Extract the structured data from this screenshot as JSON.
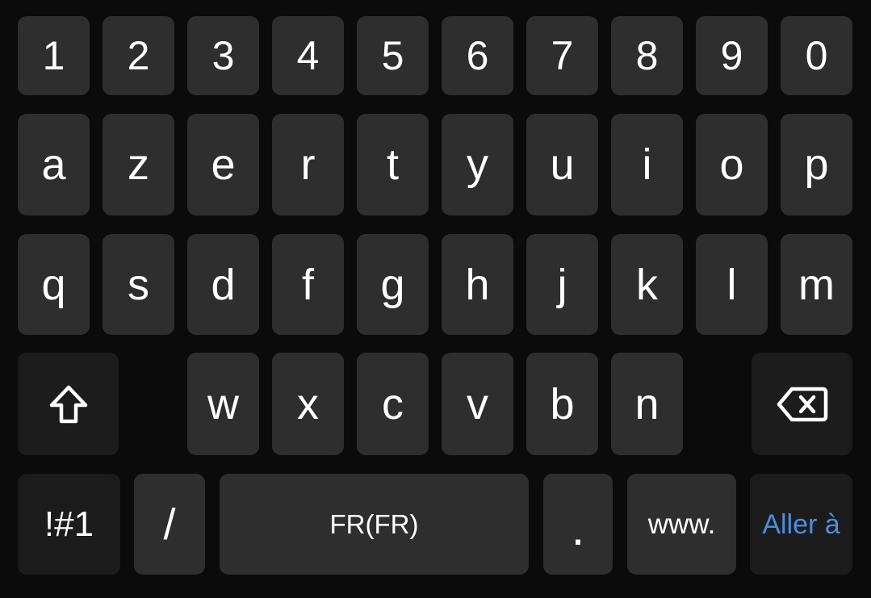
{
  "keyboard": {
    "row_numbers": [
      "1",
      "2",
      "3",
      "4",
      "5",
      "6",
      "7",
      "8",
      "9",
      "0"
    ],
    "row_top": [
      "a",
      "z",
      "e",
      "r",
      "t",
      "y",
      "u",
      "i",
      "o",
      "p"
    ],
    "row_middle": [
      "q",
      "s",
      "d",
      "f",
      "g",
      "h",
      "j",
      "k",
      "l",
      "m"
    ],
    "row_bottom": [
      "w",
      "x",
      "c",
      "v",
      "b",
      "n"
    ],
    "shift_icon": "shift-arrow-outline",
    "backspace_icon": "backspace-x",
    "symbols_label": "!#1",
    "slash_label": "/",
    "space_label": "FR(FR)",
    "period_label": ".",
    "www_label": "www.",
    "action_label": "Aller à",
    "colors": {
      "background": "#0b0b0b",
      "key": "#2e2e2e",
      "function_key": "#1c1c1c",
      "text": "#ffffff",
      "action_text": "#4a8fe0"
    }
  }
}
